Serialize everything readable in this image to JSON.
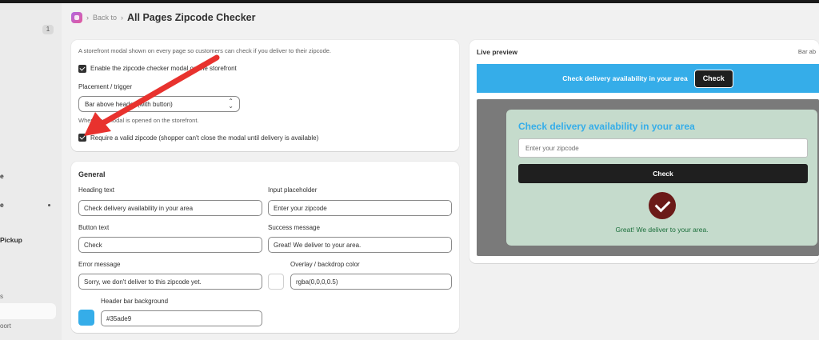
{
  "sidebar": {
    "badge": "1",
    "items": [
      {
        "label": "e"
      },
      {
        "label": "e"
      },
      {
        "label": "Pickup"
      },
      {
        "label": "s"
      },
      {
        "label": "oort"
      }
    ]
  },
  "header": {
    "back_label": "Back to",
    "title": "All Pages Zipcode Checker"
  },
  "settings": {
    "description": "A storefront modal shown on every page so customers can check if you deliver to their zipcode.",
    "enable_label": "Enable the zipcode checker modal on the storefront",
    "placement_label": "Placement / trigger",
    "placement_value": "Bar above header (with button)",
    "placement_help": "Where the modal is opened on the storefront.",
    "require_label": "Require a valid zipcode (shopper can't close the modal until delivery is available)"
  },
  "general": {
    "title": "General",
    "heading_label": "Heading text",
    "heading_value": "Check delivery availability in your area",
    "placeholder_label": "Input placeholder",
    "placeholder_value": "Enter your zipcode",
    "button_label": "Button text",
    "button_value": "Check",
    "success_label": "Success message",
    "success_value": "Great! We deliver to your area.",
    "error_label": "Error message",
    "error_value": "Sorry, we don't deliver to this zipcode yet.",
    "overlay_label": "Overlay / backdrop color",
    "overlay_value": "rgba(0,0,0,0.5)",
    "header_bg_label": "Header bar background",
    "header_bg_value": "#35ade9"
  },
  "preview": {
    "title": "Live preview",
    "mode": "Bar ab",
    "bar_text": "Check delivery availability in your area",
    "bar_button": "Check",
    "modal_heading": "Check delivery availability in your area",
    "modal_placeholder": "Enter your zipcode",
    "modal_button": "Check",
    "success_message": "Great! We deliver to your area."
  },
  "colors": {
    "header_bar": "#35ade9",
    "modal_bg": "#c5dbcc",
    "success_icon": "#6b1a18",
    "arrow": "#e8322e"
  }
}
